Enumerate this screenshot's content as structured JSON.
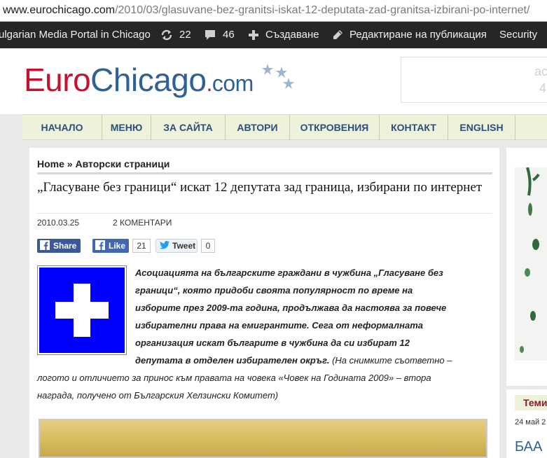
{
  "browser": {
    "url_host": "www.eurochicago.com",
    "url_path": "/2010/03/glasuvane-bez-granitsi-iskat-12-deputata-zad-granitsa-izbirani-po-internet/"
  },
  "admin_bar": {
    "site_name": "ulgarian Media Portal in Chicago",
    "updates_count": "22",
    "comments_count": "46",
    "new_label": "Създаване",
    "edit_label": "Редактиране на публикация",
    "security_label": "Security"
  },
  "header": {
    "logo_part1": "Euro",
    "logo_part2": "Chicago",
    "logo_dot": ".",
    "logo_tld": "com",
    "box_text1": "ac",
    "box_text2": "4"
  },
  "nav": {
    "items": [
      "НАЧАЛО",
      "МЕНЮ",
      "ЗА САЙТА",
      "АВТОРИ",
      "ОТКРОВЕНИЯ",
      "КОНТАКТ",
      "ENGLISH"
    ]
  },
  "article": {
    "breadcrumb_home": "Home",
    "breadcrumb_sep": "»",
    "breadcrumb_section": "Авторски страници",
    "title": "„Гласуване без граници“ искат 12 депутата зад граница, избирани по интернет",
    "date": "2010.03.25",
    "comments": "2 КОМЕНТАРИ",
    "share_label": "Share",
    "like_label": "Like",
    "like_count": "21",
    "tweet_label": "Tweet",
    "tweet_count": "0",
    "lead_lines": [
      "Асоциацията на българските граждани в чужбина „Гласуване без",
      "граници“, която придоби своята популярност по време на",
      "изборите през 2009-та година, продължава да настоява за повече",
      "избирателни права на емигрантите. Сега от неформалната",
      "организация искат българите в чужбина да си избират 12"
    ],
    "lead_last_bold": "депутата в отделен избирателен окръг.",
    "lead_last_rest": " (На снимките съответно –",
    "caption_lines": [
      "логото и отличието за принос към правата на човека  «Човек на Годината 2009» – втора",
      "награда, получено от Българския Хелзински Комитет)"
    ]
  },
  "sidebar": {
    "tab_label": "Теми",
    "date": "24 май 2",
    "big_text_small": "БАА",
    "big_text_large": "Б"
  },
  "colors": {
    "brand_red": "#c8102e",
    "brand_blue": "#2e6196",
    "nav_bg": "#eef2da",
    "flag_blue": "#0000ff"
  }
}
